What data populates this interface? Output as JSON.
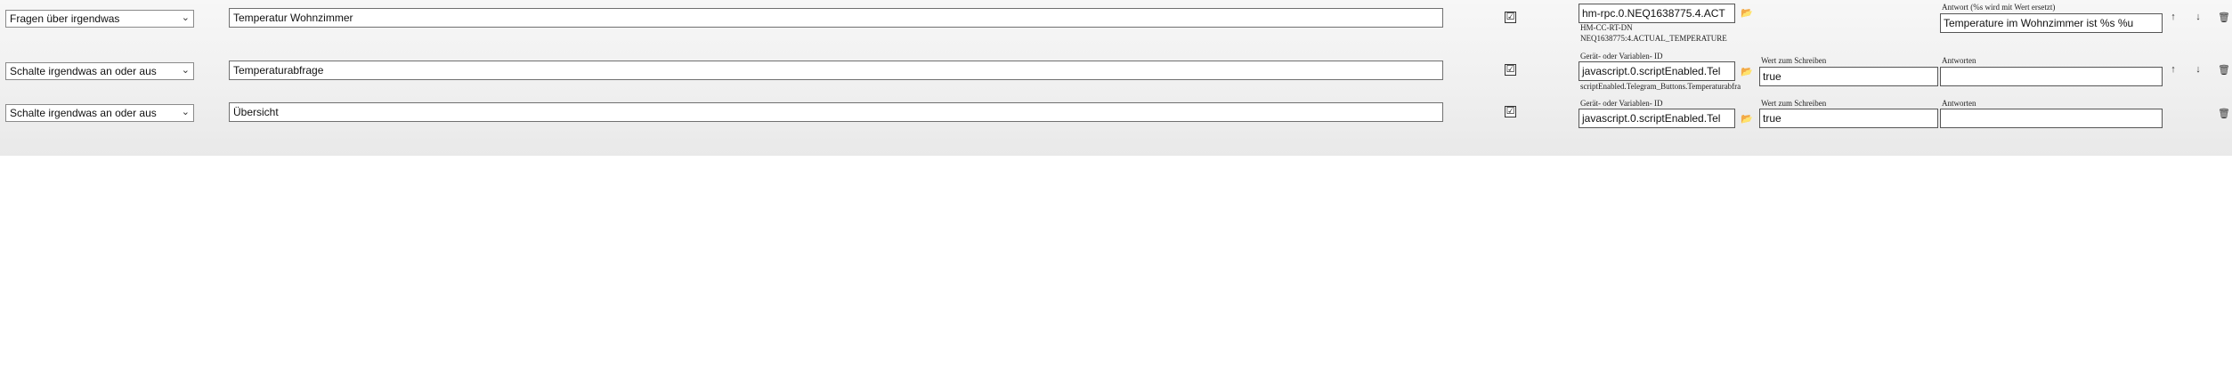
{
  "rows": [
    {
      "type": "Fragen über irgendwas",
      "text": "Temperatur Wohnzimmer",
      "checked": true,
      "device_label": "",
      "device_id": "hm-rpc.0.NEQ1638775.4.ACT",
      "device_sub": [
        "HM-CC-RT-DN",
        "NEQ1638775:4.ACTUAL_TEMPERATURE"
      ],
      "write_label": "",
      "write_value": "",
      "answer_label": "Antwort (%s wird mit Wert ersetzt)",
      "answer_value": "Temperature im Wohnzimmer ist %s %u"
    },
    {
      "type": "Schalte irgendwas an oder aus",
      "text": "Temperaturabfrage",
      "checked": true,
      "device_label": "Gerät- oder Variablen- ID",
      "device_id": "javascript.0.scriptEnabled.Tel",
      "device_sub": [
        "scriptEnabled.Telegram_Buttons.Temperaturabfra"
      ],
      "write_label": "Wert zum Schreiben",
      "write_value": "true",
      "answer_label": "Antworten",
      "answer_value": ""
    },
    {
      "type": "Schalte irgendwas an oder aus",
      "text": "Übersicht",
      "checked": true,
      "device_label": "Gerät- oder Variablen- ID",
      "device_id": "javascript.0.scriptEnabled.Tel",
      "device_sub": [],
      "write_label": "Wert zum Schreiben",
      "write_value": "true",
      "answer_label": "Antworten",
      "answer_value": ""
    }
  ],
  "icons": {
    "select_chevron": "⌄",
    "checkbox": "☑",
    "folder": "📂",
    "up": "↑",
    "down": "↓",
    "delete": "🗑"
  }
}
